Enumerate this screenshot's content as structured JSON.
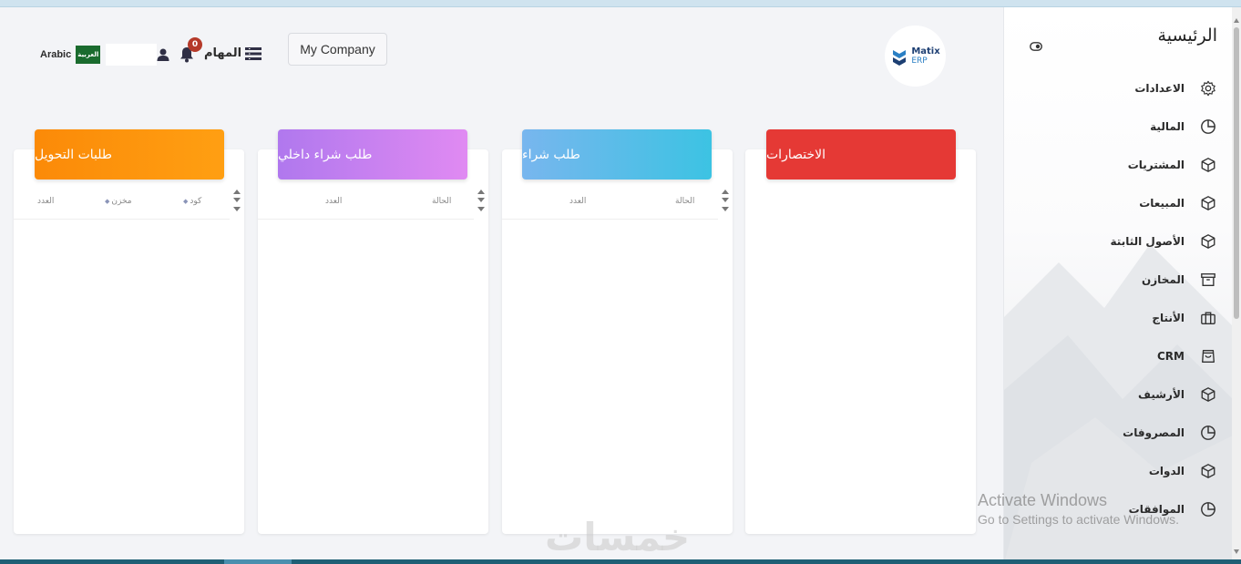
{
  "sidebar": {
    "title": "الرئيسية",
    "items": [
      {
        "label": "الاعدادات",
        "icon": "gear-icon"
      },
      {
        "label": "المالية",
        "icon": "pie-chart-icon"
      },
      {
        "label": "المشتريات",
        "icon": "cube-icon"
      },
      {
        "label": "المبيعات",
        "icon": "cube-icon"
      },
      {
        "label": "الأصول الثابتة",
        "icon": "cube-icon"
      },
      {
        "label": "المخازن",
        "icon": "archive-box-icon"
      },
      {
        "label": "الأنتاج",
        "icon": "briefcase-icon"
      },
      {
        "label": "CRM",
        "icon": "shopping-bag-icon"
      },
      {
        "label": "الأرشيف",
        "icon": "cube-icon"
      },
      {
        "label": "المصروفات",
        "icon": "pie-chart-icon"
      },
      {
        "label": "الدوات",
        "icon": "cube-icon"
      },
      {
        "label": "الموافقات",
        "icon": "pie-chart-icon"
      }
    ]
  },
  "header": {
    "logo_line1": "Matix",
    "logo_line2": "ERP",
    "company_label": "My Company",
    "tasks_label": "المهام",
    "notifications_count": "0",
    "language_label": "Arabic",
    "flag_text": "العربية"
  },
  "cards": {
    "shortcuts": {
      "title": "الاختصارات"
    },
    "purchase_request": {
      "title": "طلب شراء",
      "columns": [
        "الحالة",
        "العدد"
      ]
    },
    "internal_purchase_request": {
      "title": "طلب شراء داخلي",
      "columns": [
        "الحالة",
        "العدد"
      ]
    },
    "transfer_requests": {
      "title": "طلبات التحويل",
      "columns": [
        "كود",
        "مخزن",
        "العدد"
      ]
    }
  },
  "colors": {
    "shortcuts": "#e53935",
    "purchase_start": "#3cc3e3",
    "purchase_end": "#78b6ee",
    "internal_start": "#e08af2",
    "internal_end": "#b078ee",
    "transfer_start": "#ff9f12",
    "transfer_end": "#fb8a08"
  },
  "watermarks": {
    "activate_title": "Activate Windows",
    "activate_sub": "Go to Settings to activate Windows.",
    "site": "خمسات"
  }
}
